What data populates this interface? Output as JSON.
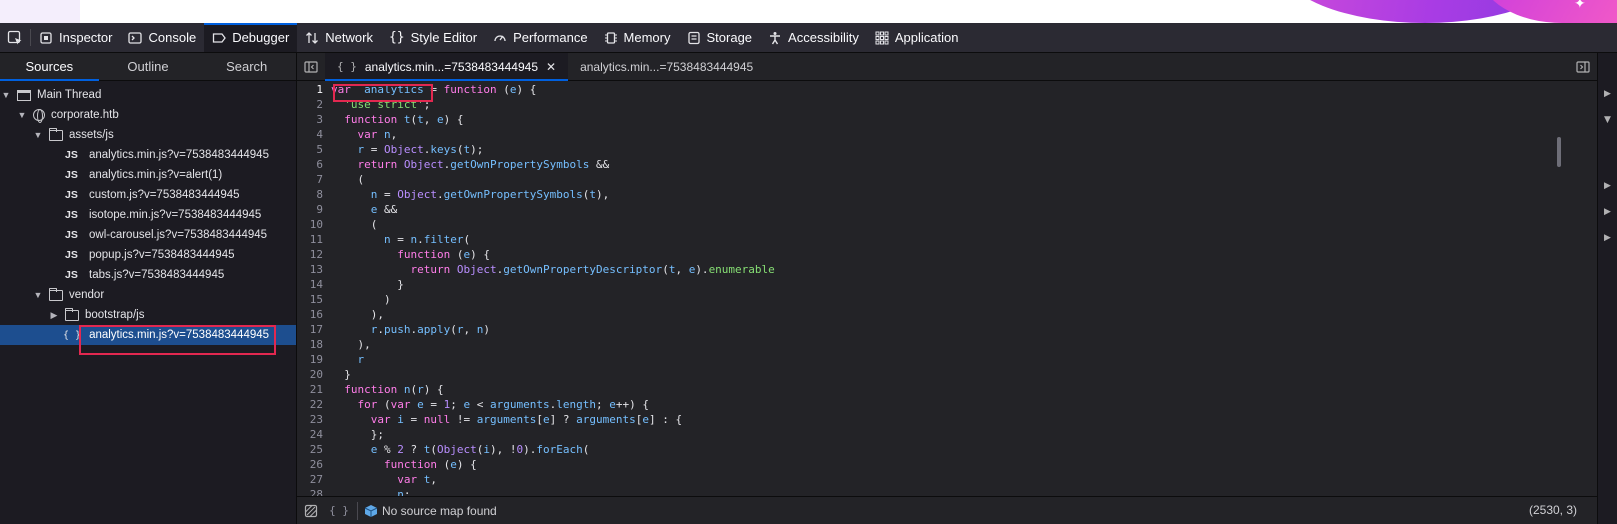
{
  "toolbar": {
    "tabs": [
      {
        "label": "Inspector",
        "icon": "inspector-icon"
      },
      {
        "label": "Console",
        "icon": "console-icon"
      },
      {
        "label": "Debugger",
        "icon": "debugger-icon"
      },
      {
        "label": "Network",
        "icon": "network-icon"
      },
      {
        "label": "Style Editor",
        "icon": "style-editor-icon"
      },
      {
        "label": "Performance",
        "icon": "performance-icon"
      },
      {
        "label": "Memory",
        "icon": "memory-icon"
      },
      {
        "label": "Storage",
        "icon": "storage-icon"
      },
      {
        "label": "Accessibility",
        "icon": "accessibility-icon"
      },
      {
        "label": "Application",
        "icon": "application-icon"
      }
    ]
  },
  "sidebar": {
    "tabs": [
      "Sources",
      "Outline",
      "Search"
    ],
    "tree": {
      "thread": "Main Thread",
      "domain": "corporate.htb",
      "assets_folder": "assets/js",
      "assets_files": [
        "analytics.min.js?v=7538483444945",
        "analytics.min.js?v=alert(1)",
        "custom.js?v=7538483444945",
        "isotope.min.js?v=7538483444945",
        "owl-carousel.js?v=7538483444945",
        "popup.js?v=7538483444945",
        "tabs.js?v=7538483444945"
      ],
      "vendor_folder": "vendor",
      "bootstrap_folder": "bootstrap/js",
      "selected_file": "analytics.min.js?v=7538483444945"
    }
  },
  "editor": {
    "tabs": [
      "analytics.min...=7538483444945",
      "analytics.min...=7538483444945"
    ],
    "lines": [
      {
        "n": "1",
        "html": "<span class=\"k\">var</span>  <span class=\"fn\">analytics</span> = <span class=\"k\">function</span> (<span class=\"fn\">e</span>) {"
      },
      {
        "n": "2",
        "html": "  <span class=\"s\">'use strict'</span>;"
      },
      {
        "n": "3",
        "html": "  <span class=\"k\">function</span> <span class=\"fn\">t</span>(<span class=\"fn\">t</span>, <span class=\"fn\">e</span>) {"
      },
      {
        "n": "4",
        "html": "    <span class=\"k\">var</span> <span class=\"fn\">n</span>,"
      },
      {
        "n": "5",
        "html": "    <span class=\"fn\">r</span> = <span class=\"b\">Object</span>.<span class=\"fn\">keys</span>(<span class=\"fn\">t</span>);"
      },
      {
        "n": "6",
        "html": "    <span class=\"k\">return</span> <span class=\"b\">Object</span>.<span class=\"fn\">getOwnPropertySymbols</span> &amp;&amp;"
      },
      {
        "n": "7",
        "html": "    ("
      },
      {
        "n": "8",
        "html": "      <span class=\"fn\">n</span> = <span class=\"b\">Object</span>.<span class=\"fn\">getOwnPropertySymbols</span>(<span class=\"fn\">t</span>),"
      },
      {
        "n": "9",
        "html": "      <span class=\"fn\">e</span> &amp;&amp;"
      },
      {
        "n": "10",
        "html": "      ("
      },
      {
        "n": "11",
        "html": "        <span class=\"fn\">n</span> = <span class=\"fn\">n</span>.<span class=\"fn\">filter</span>("
      },
      {
        "n": "12",
        "html": "          <span class=\"k\">function</span> (<span class=\"fn\">e</span>) {"
      },
      {
        "n": "13",
        "html": "            <span class=\"k\">return</span> <span class=\"b\">Object</span>.<span class=\"fn\">getOwnPropertyDescriptor</span>(<span class=\"fn\">t</span>, <span class=\"fn\">e</span>).<span class=\"s\">enumerable</span>"
      },
      {
        "n": "14",
        "html": "          }"
      },
      {
        "n": "15",
        "html": "        )"
      },
      {
        "n": "16",
        "html": "      ),"
      },
      {
        "n": "17",
        "html": "      <span class=\"fn\">r</span>.<span class=\"fn\">push</span>.<span class=\"fn\">apply</span>(<span class=\"fn\">r</span>, <span class=\"fn\">n</span>)"
      },
      {
        "n": "18",
        "html": "    ),"
      },
      {
        "n": "19",
        "html": "    <span class=\"fn\">r</span>"
      },
      {
        "n": "20",
        "html": "  }"
      },
      {
        "n": "21",
        "html": "  <span class=\"k\">function</span> <span class=\"fn\">n</span>(<span class=\"fn\">r</span>) {"
      },
      {
        "n": "22",
        "html": "    <span class=\"k\">for</span> (<span class=\"k\">var</span> <span class=\"fn\">e</span> = <span class=\"b\">1</span>; <span class=\"fn\">e</span> &lt; <span class=\"fn\">arguments</span>.<span class=\"fn\">length</span>; <span class=\"fn\">e</span>++) {"
      },
      {
        "n": "23",
        "html": "      <span class=\"k\">var</span> <span class=\"fn\">i</span> = <span class=\"k\">null</span> != <span class=\"fn\">arguments</span>[<span class=\"fn\">e</span>] ? <span class=\"fn\">arguments</span>[<span class=\"fn\">e</span>] : {"
      },
      {
        "n": "24",
        "html": "      };"
      },
      {
        "n": "25",
        "html": "      <span class=\"fn\">e</span> % <span class=\"b\">2</span> ? <span class=\"fn\">t</span>(<span class=\"b\">Object</span>(<span class=\"fn\">i</span>), !<span class=\"b\">0</span>).<span class=\"fn\">forEach</span>("
      },
      {
        "n": "26",
        "html": "        <span class=\"k\">function</span> (<span class=\"fn\">e</span>) {"
      },
      {
        "n": "27",
        "html": "          <span class=\"k\">var</span> <span class=\"fn\">t</span>,"
      },
      {
        "n": "28",
        "html": "          <span class=\"fn\">n</span>;"
      }
    ]
  },
  "footer": {
    "source_map": "No source map found",
    "position": "(2530, 3)"
  },
  "colors": {
    "accent": "#0060df",
    "highlight": "#e22850",
    "selected": "#1d4e8f"
  }
}
